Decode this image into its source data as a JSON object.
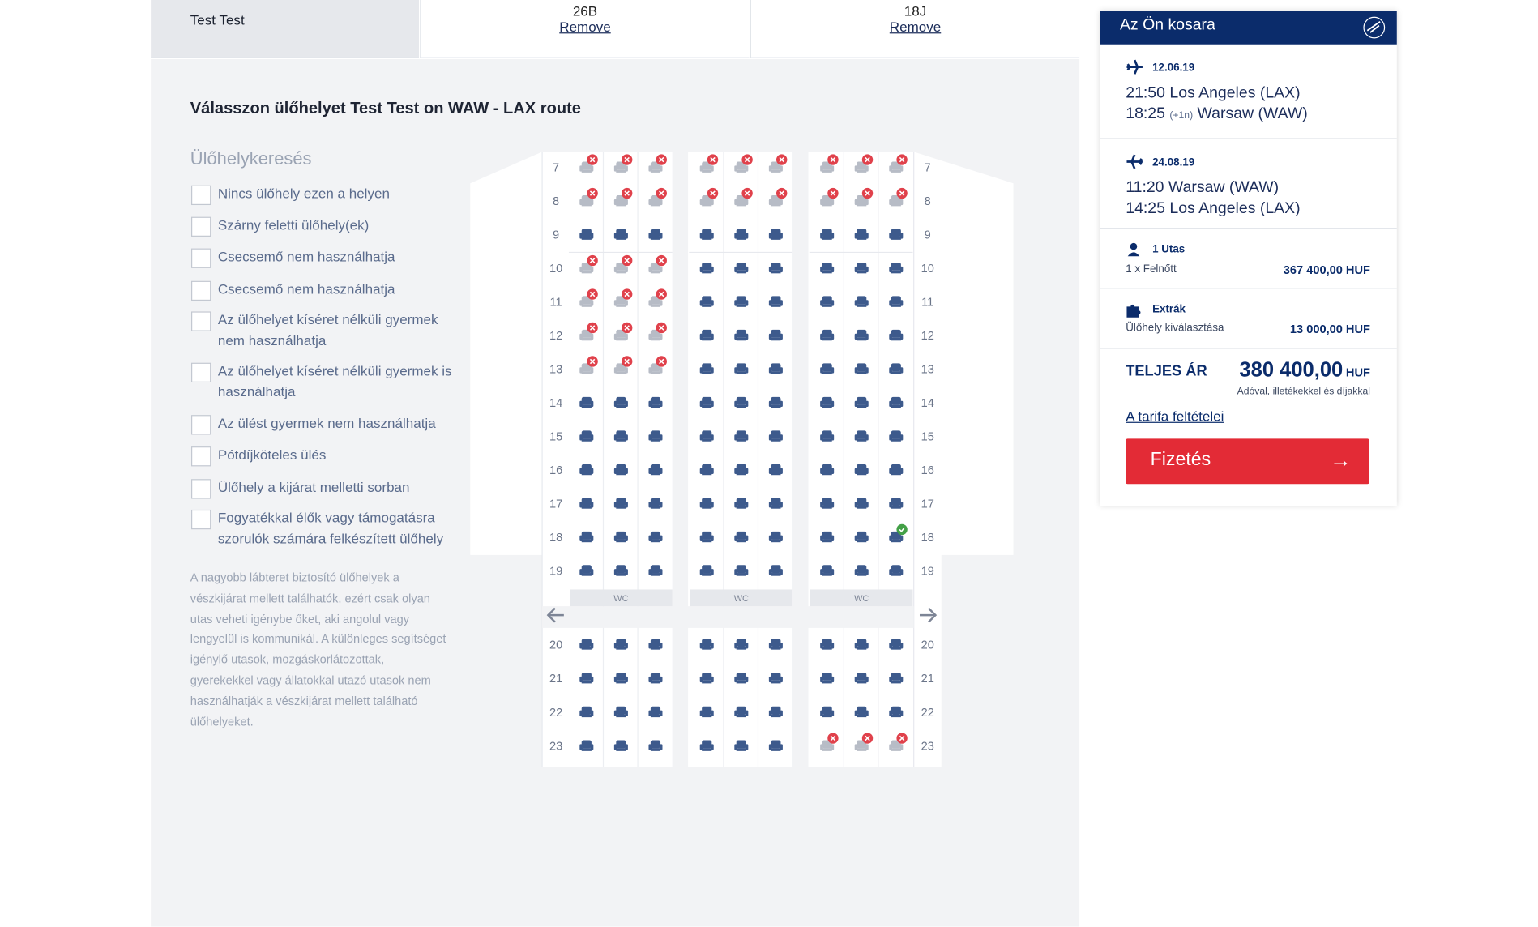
{
  "passenger_bar": {
    "name": "Test Test",
    "segments": [
      {
        "seat": "26B",
        "remove_label": "Remove"
      },
      {
        "seat": "18J",
        "remove_label": "Remove"
      }
    ]
  },
  "seat_selection": {
    "title": "Válasszon ülőhelyet Test Test on WAW - LAX route",
    "filter_heading": "Ülőhelykeresés",
    "filters": [
      "Nincs ülőhely ezen a helyen",
      "Szárny feletti ülőhely(ek)",
      "Csecsemő nem használhatja",
      "Csecsemő nem használhatja",
      "Az ülőhelyet kíséret nélküli gyermek nem használhatja",
      "Az ülőhelyet kíséret nélküli gyermek is használhatja",
      "Az ülést gyermek nem használhatja",
      "Pótdíjköteles ülés",
      "Ülőhely a kijárat melletti sorban",
      "Fogyatékkal élők vagy támogatásra szorulók számára felkészített ülőhely"
    ],
    "note": "A nagyobb lábteret biztosító ülőhelyek a vészkijárat mellett találhatók, ezért csak olyan utas veheti igénybe őket, aki angolul vagy lengyelül is kommunikál. A különleges segítséget igénylő utasok, mozgáskorlátozottak, gyerekekkel vagy állatokkal utazó utasok nem használhatják a vészkijárat mellett található ülőhelyeket."
  },
  "seat_map": {
    "rows_front": [
      "7",
      "8",
      "9",
      "10",
      "11",
      "12",
      "13",
      "14",
      "15",
      "16",
      "17",
      "18",
      "19"
    ],
    "rows_back": [
      "20",
      "21",
      "22",
      "23"
    ],
    "wc_label": "WC",
    "unavailable": [
      "7-0",
      "7-1",
      "7-2",
      "7-3",
      "7-4",
      "7-5",
      "7-6",
      "7-7",
      "7-8",
      "8-0",
      "8-1",
      "8-2",
      "8-3",
      "8-4",
      "8-5",
      "8-6",
      "8-7",
      "8-8",
      "10-0",
      "10-1",
      "10-2",
      "11-0",
      "11-1",
      "11-2",
      "12-0",
      "12-1",
      "12-2",
      "13-0",
      "13-1",
      "13-2",
      "23-6",
      "23-7",
      "23-8"
    ],
    "selected": [
      "18-8"
    ],
    "colors": {
      "seat": "#3d5a8c",
      "seat_unavailable": "#b7bcc6",
      "blocked_badge": "#e0414b",
      "selected_badge": "#43a047"
    }
  },
  "cart": {
    "title": "Az Ön kosara",
    "flights": [
      {
        "icon": "plane-outbound-icon",
        "date": "12.06.19",
        "dep_time": "21:50",
        "dep_place": "Los Angeles (LAX)",
        "arr_time": "18:25",
        "arr_note": "(+1n)",
        "arr_place": "Warsaw (WAW)"
      },
      {
        "icon": "plane-inbound-icon",
        "date": "24.08.19",
        "dep_time": "11:20",
        "dep_place": "Warsaw (WAW)",
        "arr_time": "14:25",
        "arr_note": "",
        "arr_place": "Los Angeles (LAX)"
      }
    ],
    "passengers": {
      "title": "1 Utas",
      "label": "1 x Felnőtt",
      "price": "367 400,00 HUF"
    },
    "extras": {
      "title": "Extrák",
      "label": "Ülőhely kiválasztása",
      "price": "13 000,00 HUF"
    },
    "total": {
      "label": "TELJES ÁR",
      "value": "380 400,00",
      "currency": "HUF",
      "note": "Adóval, illetékekkel és díjakkal"
    },
    "tariff_link": "A tarifa feltételei",
    "pay_label": "Fizetés",
    "pay_arrow": "→"
  }
}
